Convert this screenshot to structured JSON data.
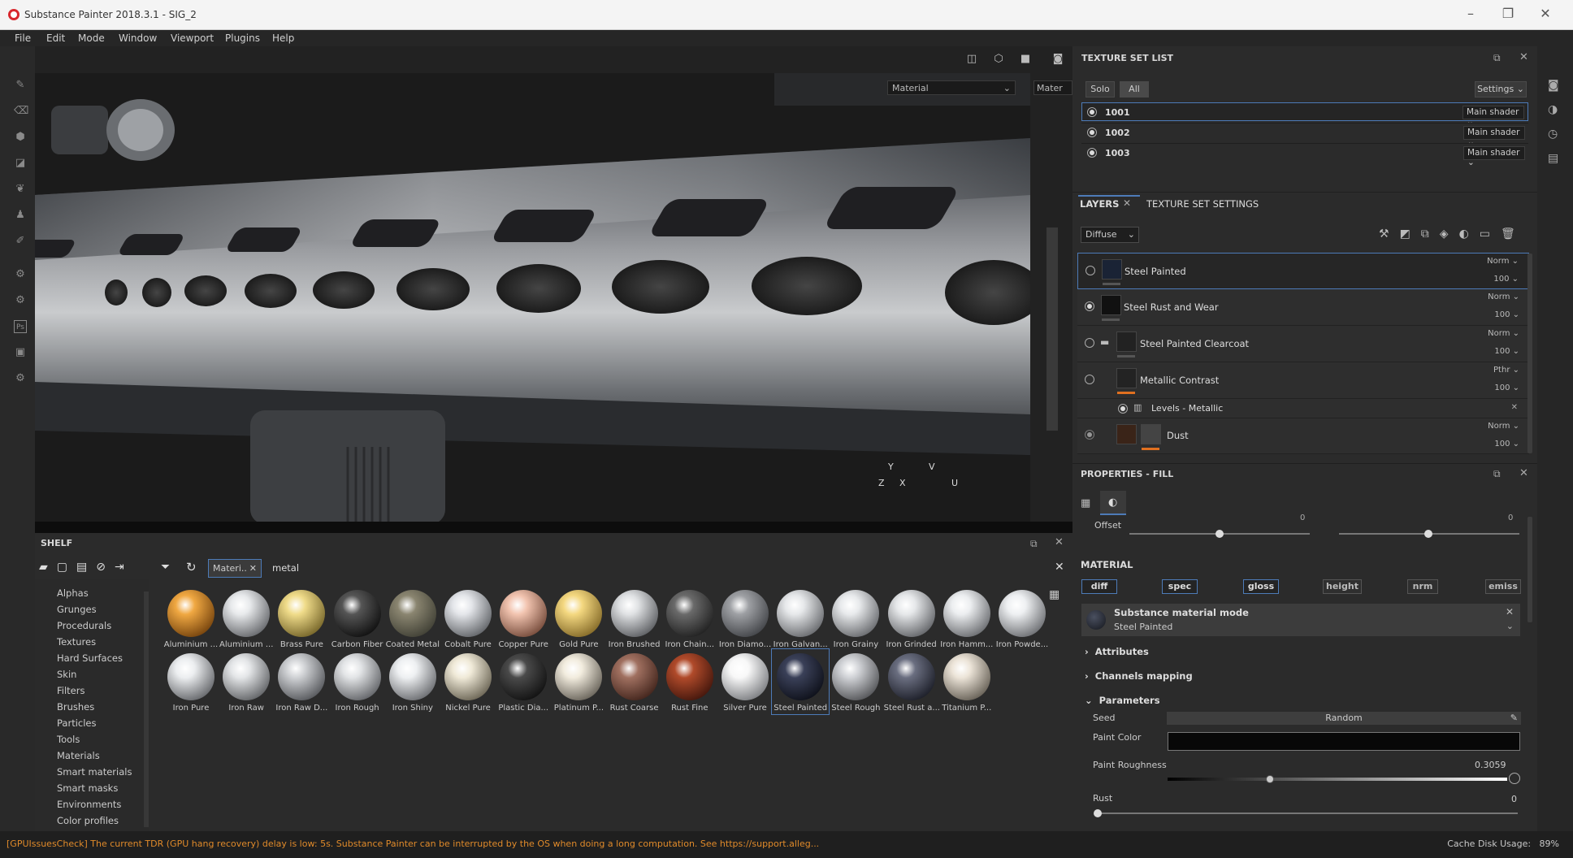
{
  "window": {
    "title": "Substance Painter 2018.3.1 - SIG_2"
  },
  "menu": [
    "File",
    "Edit",
    "Mode",
    "Window",
    "Viewport",
    "Plugins",
    "Help"
  ],
  "viewport": {
    "mode_select": "Material",
    "mode_select_2": "Mater",
    "axis_labels": [
      "Y",
      "Z",
      "X",
      "V",
      "U"
    ]
  },
  "texture_set_list": {
    "title": "TEXTURE SET LIST",
    "solo": "Solo",
    "all": "All",
    "settings": "Settings",
    "sets": [
      {
        "name": "1001",
        "shader": "Main shader"
      },
      {
        "name": "1002",
        "shader": "Main shader"
      },
      {
        "name": "1003",
        "shader": "Main shader"
      }
    ]
  },
  "layers": {
    "tab_layers": "LAYERS",
    "tab_texture_set_settings": "TEXTURE SET SETTINGS",
    "channel": "Diffuse",
    "items": [
      {
        "name": "Steel Painted",
        "blend": "Norm",
        "opacity": "100"
      },
      {
        "name": "Steel Rust and Wear",
        "blend": "Norm",
        "opacity": "100"
      },
      {
        "name": "Steel Painted Clearcoat",
        "blend": "Norm",
        "opacity": "100"
      },
      {
        "name": "Metallic Contrast",
        "blend": "Pthr",
        "opacity": "100"
      },
      {
        "name": "Levels - Metallic"
      },
      {
        "name": "Dust",
        "blend": "Norm",
        "opacity": "100"
      }
    ]
  },
  "properties": {
    "title": "PROPERTIES - FILL",
    "offset_label": "Offset",
    "offset_values": [
      "0",
      "0"
    ],
    "material_header": "MATERIAL",
    "channels": [
      "diff",
      "spec",
      "gloss",
      "height",
      "nrm",
      "emiss"
    ],
    "mode_title": "Substance material mode",
    "mode_value": "Steel Painted",
    "sections": [
      "Attributes",
      "Channels mapping",
      "Parameters"
    ],
    "seed_label": "Seed",
    "seed_button": "Random",
    "paint_color_label": "Paint Color",
    "paint_roughness_label": "Paint Roughness",
    "paint_roughness_value": "0.3059",
    "rust_label": "Rust",
    "rust_value": "0"
  },
  "shelf": {
    "title": "SHELF",
    "filter_tag": "Materi..",
    "search": "metal",
    "categories": [
      "Alphas",
      "Grunges",
      "Procedurals",
      "Textures",
      "Hard Surfaces",
      "Skin",
      "Filters",
      "Brushes",
      "Particles",
      "Tools",
      "Materials",
      "Smart materials",
      "Smart masks",
      "Environments",
      "Color profiles"
    ],
    "materials_row1": [
      "Aluminium ...",
      "Aluminium ...",
      "Brass Pure",
      "Carbon Fiber",
      "Coated Metal",
      "Cobalt Pure",
      "Copper Pure",
      "Gold Pure",
      "Iron Brushed",
      "Iron Chain...",
      "Iron Diamo...",
      "Iron Galvan...",
      "Iron Grainy",
      "Iron Grinded",
      "Iron Hamm...",
      "Iron Powde..."
    ],
    "materials_row2": [
      "Iron Pure",
      "Iron Raw",
      "Iron Raw D...",
      "Iron Rough",
      "Iron Shiny",
      "Nickel Pure",
      "Plastic Dia...",
      "Platinum P...",
      "Rust Coarse",
      "Rust Fine",
      "Silver Pure",
      "Steel Painted",
      "Steel Rough",
      "Steel Rust a...",
      "Titanium P..."
    ],
    "selected_material": "Steel Painted"
  },
  "status": {
    "warning": "[GPUIssuesCheck] The current TDR (GPU hang recovery) delay is low: 5s. Substance Painter can be interrupted by the OS when doing a long computation. See https://support.alleg...",
    "cache": "Cache Disk Usage:",
    "cache_value": "89%"
  }
}
